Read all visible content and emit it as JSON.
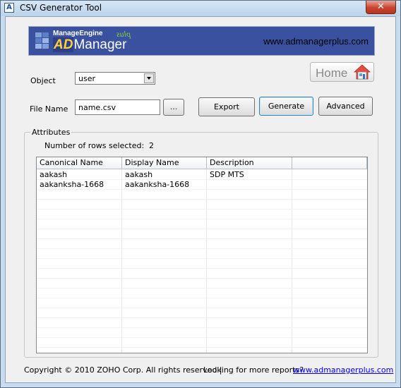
{
  "window": {
    "title": "CSV Generator Tool",
    "close_label": "✕"
  },
  "banner": {
    "logo_top": "ManageEngine",
    "logo_ad": "AD",
    "logo_manager": "Manager",
    "logo_plus": "plus",
    "url": "www.admanagerplus.com"
  },
  "form": {
    "object_label": "Object",
    "object_value": "user",
    "filename_label": "File Name",
    "filename_value": "name.csv",
    "browse_label": "...",
    "export_label": "Export",
    "generate_label": "Generate",
    "advanced_label": "Advanced",
    "home_label": "Home"
  },
  "attributes": {
    "group_label": "Attributes",
    "rows_selected_label": "Number of rows selected:",
    "rows_selected_count": "2",
    "columns": [
      "Canonical Name",
      "Display Name",
      "Description",
      ""
    ],
    "rows": [
      [
        "aakash",
        "aakash",
        "SDP MTS"
      ],
      [
        "aakanksha-1668",
        "aakanksha-1668",
        ""
      ]
    ]
  },
  "footer": {
    "copyright": "Copyright © 2010 ZOHO Corp. All rights reserved |",
    "more_reports": "Looking for more reports?",
    "link": "www.admanagerplus.com"
  }
}
